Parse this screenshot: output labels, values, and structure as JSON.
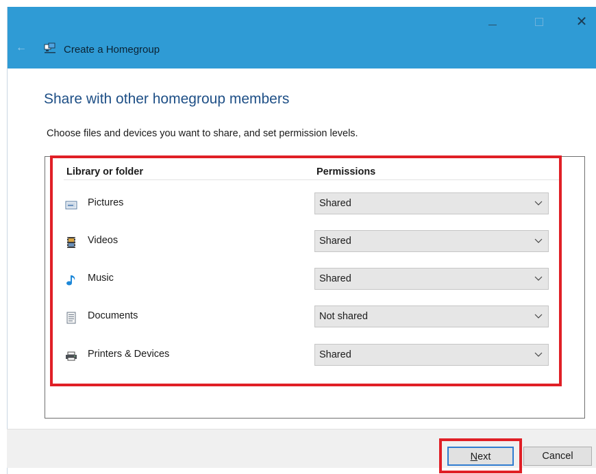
{
  "window": {
    "title": "Create a Homegroup",
    "minimize_icon": "minimize-icon",
    "maximize_icon": "maximize-icon",
    "close_glyph": "✕",
    "back_glyph": "←"
  },
  "content": {
    "heading": "Share with other homegroup members",
    "description": "Choose files and devices you want to share, and set permission levels."
  },
  "table": {
    "columns": [
      "Library or folder",
      "Permissions"
    ],
    "rows": [
      {
        "label": "Pictures",
        "icon": "pictures-icon",
        "permission": "Shared"
      },
      {
        "label": "Videos",
        "icon": "videos-icon",
        "permission": "Shared"
      },
      {
        "label": "Music",
        "icon": "music-icon",
        "permission": "Shared"
      },
      {
        "label": "Documents",
        "icon": "documents-icon",
        "permission": "Not shared"
      },
      {
        "label": "Printers & Devices",
        "icon": "printer-icon",
        "permission": "Shared"
      }
    ]
  },
  "footer": {
    "next_rest": "ext",
    "next_accel": "N",
    "cancel_label": "Cancel"
  },
  "colors": {
    "titlebar": "#2f9bd5",
    "heading": "#1e4f86",
    "highlight": "#e01f26"
  }
}
